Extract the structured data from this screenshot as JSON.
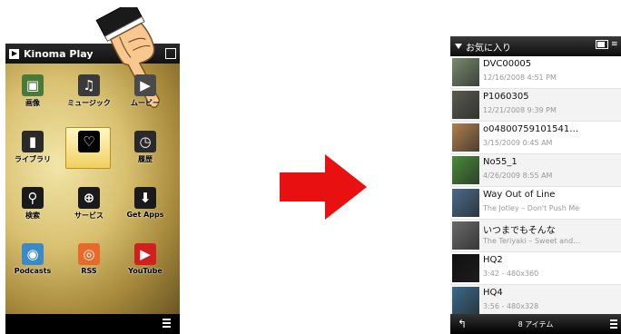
{
  "left_phone": {
    "title": "Kinoma Play",
    "grid_items": [
      {
        "label": "画像",
        "icon": "image-icon",
        "color": "#4a7a3a"
      },
      {
        "label": "ミュージック",
        "icon": "music-icon",
        "color": "#3a3a3a"
      },
      {
        "label": "ムービー",
        "icon": "movie-icon",
        "color": "#4a4a4a"
      },
      {
        "label": "ライブラリ",
        "icon": "library-icon",
        "color": "#2a2a2a"
      },
      {
        "label": "お気に入り",
        "icon": "heart-icon",
        "color": "#000000"
      },
      {
        "label": "履歴",
        "icon": "clock-icon",
        "color": "#2a2a2a"
      },
      {
        "label": "検索",
        "icon": "search-icon",
        "color": "#1a1a1a"
      },
      {
        "label": "サービス",
        "icon": "globe-icon",
        "color": "#1a1a1a"
      },
      {
        "label": "Get Apps",
        "icon": "download-icon",
        "color": "#1a1a1a"
      },
      {
        "label": "Podcasts",
        "icon": "podcast-icon",
        "color": "#3a8ac8"
      },
      {
        "label": "RSS",
        "icon": "rss-icon",
        "color": "#e86a2a"
      },
      {
        "label": "YouTube",
        "icon": "youtube-icon",
        "color": "#d02020"
      }
    ]
  },
  "right_phone": {
    "title": "お気に入り",
    "items": [
      {
        "title": "DVC00005",
        "sub": "12/16/2008 4:51 PM",
        "thumb": "#7a8a70"
      },
      {
        "title": "P1060305",
        "sub": "12/21/2008 9:39 PM",
        "thumb": "#5a5a52"
      },
      {
        "title": "o04800759101541…",
        "sub": "3/15/2009 0:45 AM",
        "thumb": "#b08050"
      },
      {
        "title": "No55_1",
        "sub": "4/26/2009 8:55 AM",
        "thumb": "#4a8a3a"
      },
      {
        "title": "Way Out of Line",
        "sub": "The Jotley – Don't Push Me",
        "thumb": "#4a6a8a"
      },
      {
        "title": "いつまでもそんな",
        "sub": "The Teriyaki – Sweet and…",
        "thumb": "#6a6a6a"
      },
      {
        "title": "HQ2",
        "sub": "3:42 - 480x360",
        "thumb": "#101010"
      },
      {
        "title": "HQ4",
        "sub": "3:56 - 480x328",
        "thumb": "#3a6a8a"
      }
    ],
    "footer_count": "8 アイテム"
  },
  "colors": {
    "arrow": "#e81010",
    "hand_fill": "#f8c890"
  }
}
